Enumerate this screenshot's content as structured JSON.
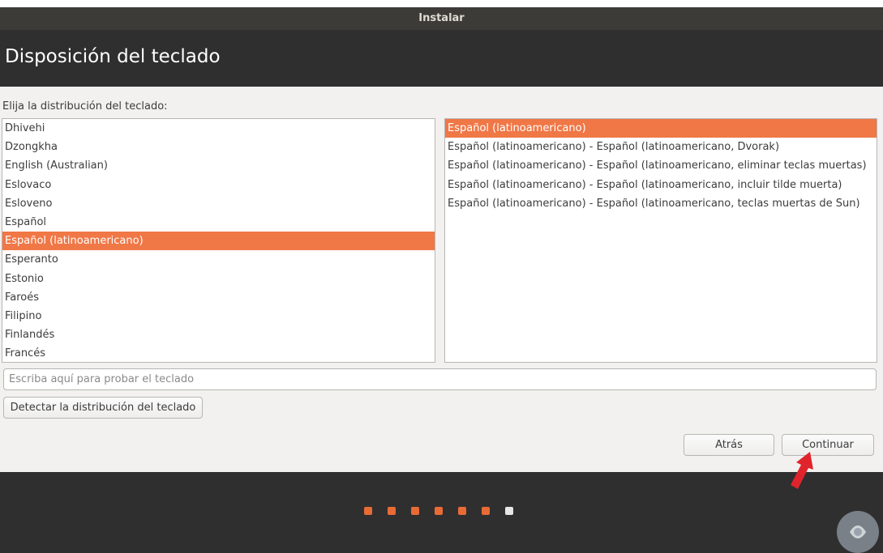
{
  "window": {
    "title": "Instalar"
  },
  "header": {
    "title": "Disposición del teclado"
  },
  "prompt": "Elija la distribución del teclado:",
  "layouts": [
    {
      "label": "Dhivehi",
      "selected": false
    },
    {
      "label": "Dzongkha",
      "selected": false
    },
    {
      "label": "English (Australian)",
      "selected": false
    },
    {
      "label": "Eslovaco",
      "selected": false
    },
    {
      "label": "Esloveno",
      "selected": false
    },
    {
      "label": "Español",
      "selected": false
    },
    {
      "label": "Español (latinoamericano)",
      "selected": true
    },
    {
      "label": "Esperanto",
      "selected": false
    },
    {
      "label": "Estonio",
      "selected": false
    },
    {
      "label": "Faroés",
      "selected": false
    },
    {
      "label": "Filipino",
      "selected": false
    },
    {
      "label": "Finlandés",
      "selected": false
    },
    {
      "label": "Francés",
      "selected": false
    }
  ],
  "variants": [
    {
      "label": "Español (latinoamericano)",
      "selected": true
    },
    {
      "label": "Español (latinoamericano) - Español (latinoamericano, Dvorak)",
      "selected": false
    },
    {
      "label": "Español (latinoamericano) - Español (latinoamericano, eliminar teclas muertas)",
      "selected": false
    },
    {
      "label": "Español (latinoamericano) - Español (latinoamericano, incluir tilde muerta)",
      "selected": false
    },
    {
      "label": "Español (latinoamericano) - Español (latinoamericano, teclas muertas de Sun)",
      "selected": false
    }
  ],
  "test_input": {
    "placeholder": "Escriba aquí para probar el teclado",
    "value": ""
  },
  "buttons": {
    "detect": "Detectar la distribución del teclado",
    "back": "Atrás",
    "continue": "Continuar"
  },
  "progress": {
    "total_steps": 7,
    "current_step": 7
  },
  "colors": {
    "accent": "#f07746",
    "dark": "#2f2f2f",
    "titlebar": "#3c3b37",
    "arrow": "#e0242b"
  },
  "icons": {
    "pointer": "red-arrow-icon",
    "watermark": "watermark-logo-icon"
  }
}
